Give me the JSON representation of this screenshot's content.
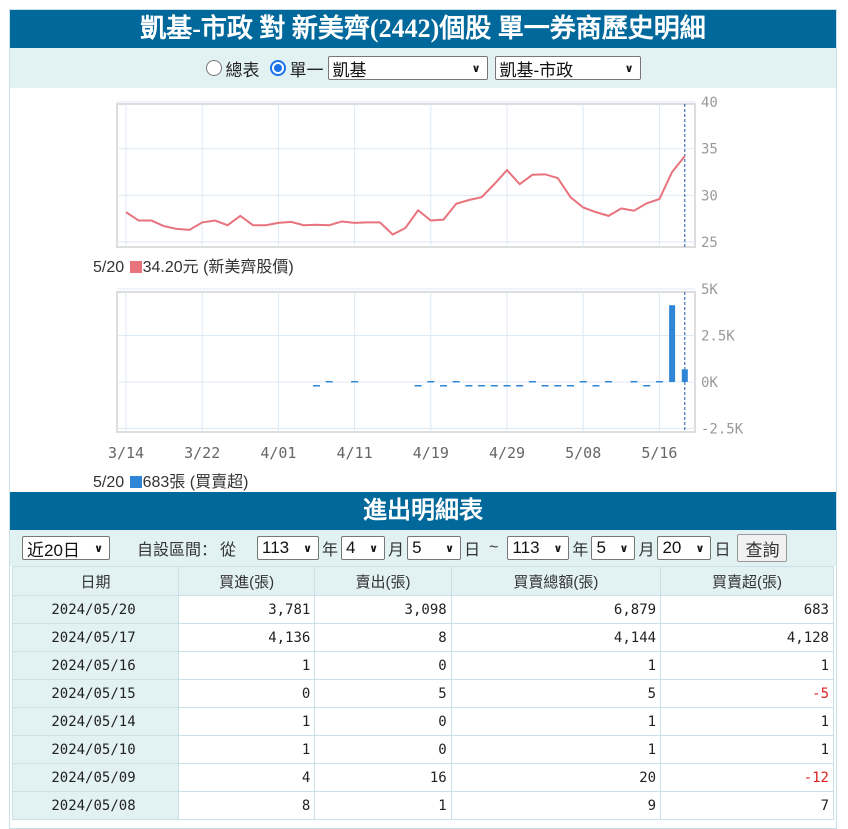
{
  "header": {
    "title": "凱基-市政 對 新美齊(2442)個股 單一券商歷史明細"
  },
  "mode": {
    "all_label": "總表",
    "single_label": "單一",
    "selected": "single",
    "broker_select": "凱基",
    "branch_select": "凱基-市政"
  },
  "colors": {
    "header": "#00689a",
    "price": "#e8737c",
    "net": "#2f86d6",
    "negative": "#e02020"
  },
  "chart_data": [
    {
      "type": "line",
      "title": "新美齊股價",
      "ylim": [
        25,
        40
      ],
      "yticks": [
        "40",
        "35",
        "30",
        "25"
      ],
      "ytick_values": [
        40,
        35,
        30,
        25
      ],
      "values": [
        28.2,
        27.3,
        27.3,
        26.7,
        26.4,
        26.3,
        27.1,
        27.3,
        26.8,
        27.8,
        26.8,
        26.8,
        27.05,
        27.15,
        26.8,
        26.85,
        26.8,
        27.2,
        27.05,
        27.1,
        27.1,
        25.8,
        26.5,
        28.4,
        27.3,
        27.4,
        29.1,
        29.5,
        29.8,
        31.2,
        32.7,
        31.2,
        32.2,
        32.25,
        31.85,
        29.8,
        28.7,
        28.2,
        27.8,
        28.6,
        28.35,
        29.15,
        29.6,
        32.5,
        34.2
      ],
      "legend": {
        "date": "5/20",
        "value": "34.20元",
        "label": "(新美齊股價)"
      }
    },
    {
      "type": "bar",
      "title": "買賣超",
      "ylim": [
        -2500,
        5000
      ],
      "yticks": [
        "5K",
        "2.5K",
        "0K",
        "-2.5K"
      ],
      "ytick_values": [
        5000,
        2500,
        0,
        -2500
      ],
      "xticks": [
        "3/14",
        "3/22",
        "4/01",
        "4/11",
        "4/19",
        "4/29",
        "5/08",
        "5/16"
      ],
      "xtick_index": [
        0,
        6,
        12,
        18,
        24,
        30,
        36,
        42
      ],
      "values": [
        null,
        null,
        null,
        null,
        null,
        null,
        null,
        null,
        null,
        null,
        null,
        null,
        null,
        null,
        null,
        -3,
        2,
        null,
        1,
        null,
        null,
        null,
        null,
        -4,
        3,
        -6,
        2,
        -5,
        -3,
        -8,
        -2,
        -4,
        3,
        -3,
        -6,
        -2,
        7,
        -12,
        1,
        null,
        1,
        -5,
        1,
        4128,
        683
      ],
      "legend": {
        "date": "5/20",
        "value": "683張",
        "label": "(買賣超)"
      }
    }
  ],
  "detail": {
    "title": "進出明細表",
    "range_select": "近20日",
    "custom_label": "自設區間：",
    "from_label": "從",
    "from": {
      "year": "113",
      "month": "4",
      "day": "5"
    },
    "to": {
      "year": "113",
      "month": "5",
      "day": "20"
    },
    "year_unit": "年",
    "month_unit": "月",
    "day_unit": "日",
    "tilde": "~",
    "query_button": "查詢",
    "columns": [
      "日期",
      "買進(張)",
      "賣出(張)",
      "買賣總額(張)",
      "買賣超(張)"
    ],
    "rows": [
      [
        "2024/05/20",
        "3,781",
        "3,098",
        "6,879",
        "683"
      ],
      [
        "2024/05/17",
        "4,136",
        "8",
        "4,144",
        "4,128"
      ],
      [
        "2024/05/16",
        "1",
        "0",
        "1",
        "1"
      ],
      [
        "2024/05/15",
        "0",
        "5",
        "5",
        "-5"
      ],
      [
        "2024/05/14",
        "1",
        "0",
        "1",
        "1"
      ],
      [
        "2024/05/10",
        "1",
        "0",
        "1",
        "1"
      ],
      [
        "2024/05/09",
        "4",
        "16",
        "20",
        "-12"
      ],
      [
        "2024/05/08",
        "8",
        "1",
        "9",
        "7"
      ]
    ]
  }
}
